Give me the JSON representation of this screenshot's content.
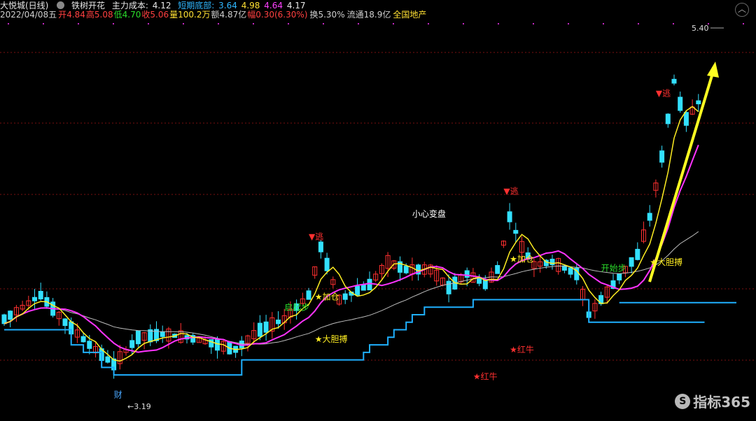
{
  "header": {
    "stock_name": "大悦城(日线)",
    "strategy": "铁树开花",
    "main_cost_label": "主力成本:",
    "main_cost_value": "4.12",
    "short_bottom_label": "短期底部:",
    "short_bottom_v1": "3.64",
    "short_bottom_v2": "4.98",
    "short_bottom_v3": "4.64",
    "short_bottom_v4": "4.17",
    "date": "2022/04/08五",
    "open_label": "开",
    "open": "4.84",
    "high_label": "高",
    "high": "5.08",
    "low_label": "低",
    "low": "4.70",
    "close_label": "收",
    "close": "5.06",
    "volume_label": "量",
    "volume": "100.2万",
    "amount_label": "额",
    "amount": "4.87亿",
    "change_label": "幅",
    "change": "0.30(6.30%)",
    "turnover_label": "换",
    "turnover": "5.30%",
    "float_label": "流通",
    "float": "18.9亿",
    "sector": "全国地产"
  },
  "watermark": {
    "text": "指标365",
    "logo": "S"
  },
  "colors": {
    "up": "#ff3030",
    "down": "#33e0ff",
    "ma_white": "#bdbdbd",
    "ma_magenta": "#ff33ff",
    "ma_yellow": "#ffee22",
    "cost": "#1fb0ff",
    "arrow": "#ffff22",
    "grid": "#7a1010"
  },
  "chart_data": {
    "type": "candlestick",
    "ylim": [
      3.0,
      5.6
    ],
    "price_labels": {
      "max": "5.40",
      "min": "3.19"
    },
    "annotations": [
      {
        "text": "▼逃",
        "color": "#ff3030",
        "day": 107,
        "price": 5.1
      },
      {
        "text": "▼逃",
        "color": "#ff3030",
        "day": 82,
        "price": 4.45
      },
      {
        "text": "▼逃",
        "color": "#ff3030",
        "day": 50,
        "price": 4.15
      },
      {
        "text": "小心变盘",
        "color": "#ffffff",
        "day": 67,
        "price": 4.3
      },
      {
        "text": "★加仓",
        "color": "#ffee22",
        "day": 51,
        "price": 3.75
      },
      {
        "text": "★加仓",
        "color": "#ffee22",
        "day": 83,
        "price": 4.0
      },
      {
        "text": "启起步",
        "color": "#2bdc2b",
        "day": 46,
        "price": 3.68
      },
      {
        "text": "开始步",
        "color": "#2bdc2b",
        "day": 98,
        "price": 3.94
      },
      {
        "text": "★大胆搏",
        "color": "#ffee22",
        "day": 51,
        "price": 3.47
      },
      {
        "text": "★大胆搏",
        "color": "#ffee22",
        "day": 106,
        "price": 3.98
      },
      {
        "text": "★红牛",
        "color": "#ff3030",
        "day": 83,
        "price": 3.4
      },
      {
        "text": "★红牛",
        "color": "#ff3030",
        "day": 77,
        "price": 3.22
      },
      {
        "text": "财",
        "color": "#4aa8ff",
        "day": 18,
        "price": 3.1
      }
    ]
  }
}
